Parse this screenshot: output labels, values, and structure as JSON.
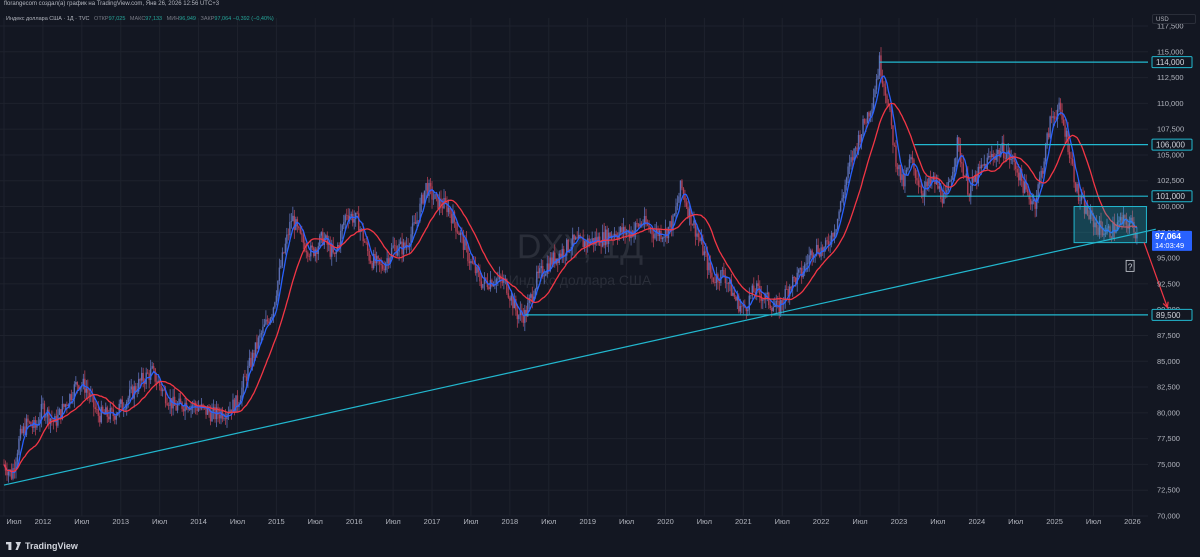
{
  "header": {
    "attribution": "florangecom создал(а) график на TradingView.com, Янв 26, 2026 12:56 UTC+3"
  },
  "legend": {
    "title": "Индекс доллара США · 1Д · TVC",
    "open_label": "ОТКР",
    "open_value": "97,025",
    "high_label": "МАКС",
    "high_value": "97,133",
    "low_label": "МИН",
    "low_value": "96,949",
    "close_label": "ЗАКР",
    "close_value": "97,064",
    "change": "−0,392 (−0,40%)"
  },
  "currency": "USD",
  "watermark": {
    "symbol": "DXY, 1Д",
    "name": "Индекс доллара США"
  },
  "brand": "TradingView",
  "colors": {
    "background": "#131722",
    "grid": "#1e222d",
    "up": "#5d6fb5",
    "down": "#b04055",
    "ma_fast": "#2962ff",
    "ma_slow": "#f23645",
    "levels": "#22b8cf",
    "last_price_bg": "#2962ff",
    "arrow": "#f23645"
  },
  "chart_data": {
    "type": "candlestick",
    "y_axis": {
      "min": 70,
      "max": 117.5,
      "ticks": [
        "117,500",
        "115,000",
        "112,500",
        "110,000",
        "107,500",
        "105,000",
        "102,500",
        "100,000",
        "97,500",
        "95,000",
        "92,500",
        "90,000",
        "87,500",
        "85,000",
        "82,500",
        "80,000",
        "77,500",
        "75,000",
        "72,500",
        "70,000"
      ]
    },
    "x_axis": {
      "range": [
        2011.5,
        2026.2
      ],
      "ticks": [
        {
          "label": "Июл",
          "t": 2011.5
        },
        {
          "label": "2012",
          "t": 2012.0
        },
        {
          "label": "Июл",
          "t": 2012.5
        },
        {
          "label": "2013",
          "t": 2013.0
        },
        {
          "label": "Июл",
          "t": 2013.5
        },
        {
          "label": "2014",
          "t": 2014.0
        },
        {
          "label": "Июл",
          "t": 2014.5
        },
        {
          "label": "2015",
          "t": 2015.0
        },
        {
          "label": "Июл",
          "t": 2015.5
        },
        {
          "label": "2016",
          "t": 2016.0
        },
        {
          "label": "Июл",
          "t": 2016.5
        },
        {
          "label": "2017",
          "t": 2017.0
        },
        {
          "label": "Июл",
          "t": 2017.5
        },
        {
          "label": "2018",
          "t": 2018.0
        },
        {
          "label": "Июл",
          "t": 2018.5
        },
        {
          "label": "2019",
          "t": 2019.0
        },
        {
          "label": "Июл",
          "t": 2019.5
        },
        {
          "label": "2020",
          "t": 2020.0
        },
        {
          "label": "Июл",
          "t": 2020.5
        },
        {
          "label": "2021",
          "t": 2021.0
        },
        {
          "label": "Июл",
          "t": 2021.5
        },
        {
          "label": "2022",
          "t": 2022.0
        },
        {
          "label": "Июл",
          "t": 2022.5
        },
        {
          "label": "2023",
          "t": 2023.0
        },
        {
          "label": "Июл",
          "t": 2023.5
        },
        {
          "label": "2024",
          "t": 2024.0
        },
        {
          "label": "Июл",
          "t": 2024.5
        },
        {
          "label": "2025",
          "t": 2025.0
        },
        {
          "label": "Июл",
          "t": 2025.5
        },
        {
          "label": "2026",
          "t": 2026.0
        }
      ]
    },
    "price_path": [
      [
        2011.5,
        75.0
      ],
      [
        2011.6,
        74.0
      ],
      [
        2011.7,
        77.5
      ],
      [
        2011.8,
        79.0
      ],
      [
        2011.9,
        78.5
      ],
      [
        2012.0,
        80.5
      ],
      [
        2012.15,
        79.0
      ],
      [
        2012.3,
        81.0
      ],
      [
        2012.45,
        83.0
      ],
      [
        2012.55,
        82.5
      ],
      [
        2012.7,
        79.8
      ],
      [
        2012.9,
        79.8
      ],
      [
        2013.1,
        81.5
      ],
      [
        2013.25,
        83.0
      ],
      [
        2013.4,
        84.0
      ],
      [
        2013.55,
        82.0
      ],
      [
        2013.7,
        80.5
      ],
      [
        2013.85,
        81.0
      ],
      [
        2014.0,
        80.5
      ],
      [
        2014.2,
        79.8
      ],
      [
        2014.35,
        80.2
      ],
      [
        2014.5,
        81.0
      ],
      [
        2014.65,
        84.5
      ],
      [
        2014.8,
        87.5
      ],
      [
        2014.95,
        90.0
      ],
      [
        2015.05,
        94.0
      ],
      [
        2015.2,
        99.0
      ],
      [
        2015.3,
        97.0
      ],
      [
        2015.45,
        95.5
      ],
      [
        2015.6,
        97.0
      ],
      [
        2015.75,
        95.0
      ],
      [
        2015.9,
        99.5
      ],
      [
        2016.05,
        98.5
      ],
      [
        2016.2,
        95.0
      ],
      [
        2016.35,
        94.0
      ],
      [
        2016.5,
        96.0
      ],
      [
        2016.65,
        96.0
      ],
      [
        2016.8,
        98.5
      ],
      [
        2016.92,
        102.0
      ],
      [
        2017.05,
        100.5
      ],
      [
        2017.2,
        100.0
      ],
      [
        2017.35,
        97.5
      ],
      [
        2017.5,
        94.5
      ],
      [
        2017.65,
        92.5
      ],
      [
        2017.8,
        93.0
      ],
      [
        2017.95,
        92.5
      ],
      [
        2018.1,
        89.5
      ],
      [
        2018.2,
        89.5
      ],
      [
        2018.35,
        93.0
      ],
      [
        2018.5,
        94.5
      ],
      [
        2018.65,
        95.5
      ],
      [
        2018.8,
        96.5
      ],
      [
        2018.95,
        96.5
      ],
      [
        2019.15,
        96.8
      ],
      [
        2019.35,
        97.5
      ],
      [
        2019.55,
        97.5
      ],
      [
        2019.7,
        98.5
      ],
      [
        2019.85,
        97.5
      ],
      [
        2020.0,
        97.5
      ],
      [
        2020.1,
        98.5
      ],
      [
        2020.2,
        102.0
      ],
      [
        2020.3,
        99.5
      ],
      [
        2020.45,
        96.5
      ],
      [
        2020.6,
        93.0
      ],
      [
        2020.75,
        93.5
      ],
      [
        2020.9,
        91.0
      ],
      [
        2021.0,
        90.0
      ],
      [
        2021.15,
        92.0
      ],
      [
        2021.3,
        91.0
      ],
      [
        2021.45,
        90.0
      ],
      [
        2021.6,
        92.5
      ],
      [
        2021.75,
        93.5
      ],
      [
        2021.9,
        96.0
      ],
      [
        2022.05,
        95.8
      ],
      [
        2022.2,
        98.5
      ],
      [
        2022.35,
        103.5
      ],
      [
        2022.5,
        107.0
      ],
      [
        2022.65,
        110.0
      ],
      [
        2022.75,
        114.0
      ],
      [
        2022.85,
        110.5
      ],
      [
        2022.95,
        105.0
      ],
      [
        2023.05,
        102.0
      ],
      [
        2023.15,
        104.5
      ],
      [
        2023.3,
        101.5
      ],
      [
        2023.45,
        102.5
      ],
      [
        2023.6,
        100.5
      ],
      [
        2023.75,
        106.0
      ],
      [
        2023.9,
        101.5
      ],
      [
        2024.05,
        103.5
      ],
      [
        2024.2,
        105.0
      ],
      [
        2024.35,
        105.5
      ],
      [
        2024.5,
        104.0
      ],
      [
        2024.65,
        101.0
      ],
      [
        2024.75,
        100.5
      ],
      [
        2024.85,
        104.0
      ],
      [
        2024.95,
        108.5
      ],
      [
        2025.05,
        109.5
      ],
      [
        2025.15,
        107.0
      ],
      [
        2025.3,
        101.0
      ],
      [
        2025.45,
        99.0
      ],
      [
        2025.55,
        98.0
      ],
      [
        2025.7,
        97.5
      ],
      [
        2025.85,
        98.5
      ],
      [
        2026.0,
        98.3
      ],
      [
        2026.07,
        97.06
      ]
    ],
    "levels": [
      {
        "label": "114,000",
        "value": 114.0,
        "from": 2022.75
      },
      {
        "label": "106,000",
        "value": 106.0,
        "from": 2023.2
      },
      {
        "label": "101,000",
        "value": 101.0,
        "from": 2023.1
      },
      {
        "label": "89,500",
        "value": 89.5,
        "from": 2018.2
      }
    ],
    "trendline": {
      "p1": [
        2011.5,
        73.0
      ],
      "p2": [
        2026.3,
        97.8
      ]
    },
    "range_box": {
      "x1": 2025.25,
      "x2": 2026.18,
      "y1": 96.5,
      "y2": 100.0
    },
    "projection_arrow": {
      "from": [
        2026.15,
        96.5
      ],
      "to": [
        2026.45,
        90.2
      ]
    },
    "question_mark": {
      "label": "?",
      "t": 2025.97,
      "y": 94.2
    },
    "last_price": {
      "value": 97.064,
      "label": "97,064",
      "countdown": "14:03:49"
    }
  }
}
